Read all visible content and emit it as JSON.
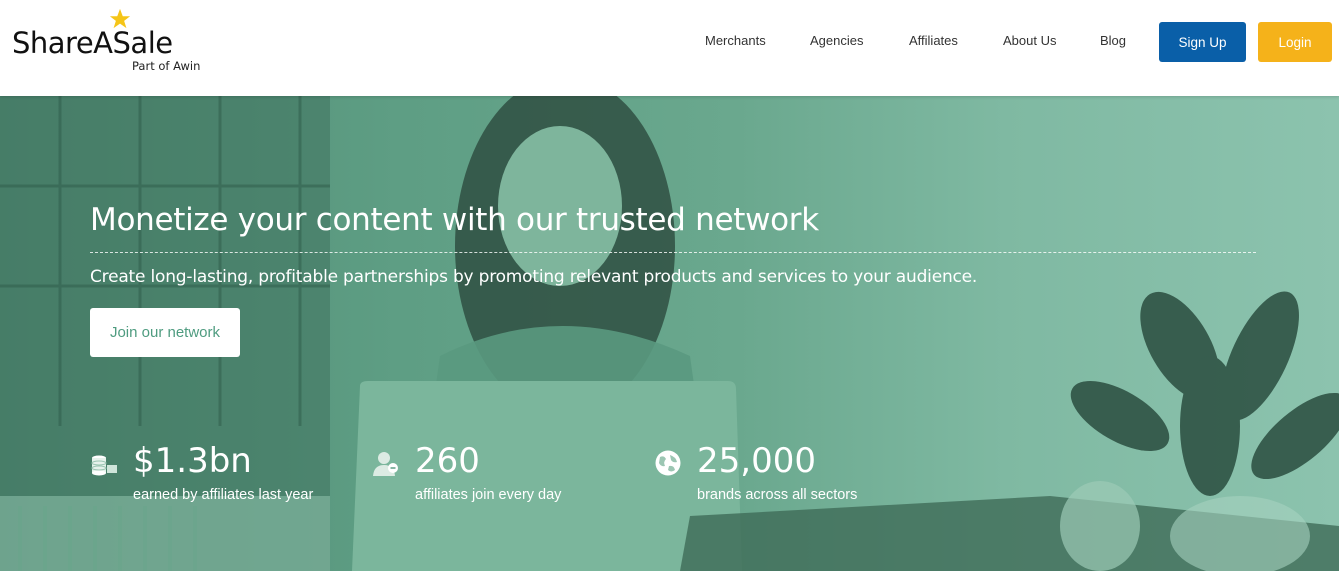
{
  "logo": {
    "name": "ShareASale",
    "tagline": "Part of Awin"
  },
  "nav": {
    "items": [
      {
        "label": "Merchants"
      },
      {
        "label": "Agencies"
      },
      {
        "label": "Affiliates"
      },
      {
        "label": "About Us"
      },
      {
        "label": "Blog"
      }
    ],
    "signup_label": "Sign Up",
    "login_label": "Login"
  },
  "hero": {
    "title": "Monetize your content with our trusted network",
    "subtitle": "Create long-lasting, profitable partnerships by promoting relevant products and services to your audience.",
    "cta_label": "Join our network"
  },
  "stats": [
    {
      "icon": "coins-icon",
      "value": "$1.3bn",
      "label": "earned by affiliates last year"
    },
    {
      "icon": "person-add-icon",
      "value": "260",
      "label": "affiliates join every day"
    },
    {
      "icon": "globe-icon",
      "value": "25,000",
      "label": "brands across all sectors"
    }
  ],
  "colors": {
    "signup": "#0a5fa8",
    "login": "#f5b21a",
    "hero_tint": "#5e9e84",
    "star": "#f5c518"
  }
}
